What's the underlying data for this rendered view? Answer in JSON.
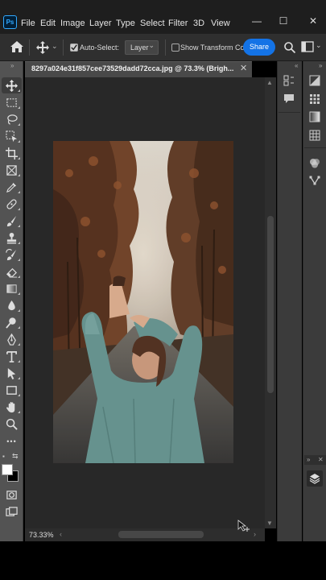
{
  "app": {
    "logo": "Ps"
  },
  "menu": [
    "File",
    "Edit",
    "Image",
    "Layer",
    "Type",
    "Select",
    "Filter",
    "3D",
    "View"
  ],
  "window_controls": {
    "minimize": "—",
    "maximize": "☐",
    "close": "✕"
  },
  "options_bar": {
    "auto_select_label": "Auto-Select:",
    "auto_select_checked": true,
    "target_value": "Layer",
    "show_transform_label": "Show Transform Cont",
    "show_transform_checked": false,
    "share_label": "Share",
    "collapse": "»"
  },
  "document": {
    "tab_title": "8297a024e31f857cee73529dadd72cca.jpg @ 73.3% (Brigh...",
    "close": "✕",
    "zoom": "73.33%"
  },
  "toolbar": {
    "collapse": "»",
    "tools": [
      "move-icon",
      "marquee-icon",
      "lasso-icon",
      "object-select-icon",
      "crop-icon",
      "frame-icon",
      "eyedropper-icon",
      "healing-icon",
      "brush-icon",
      "stamp-icon",
      "history-brush-icon",
      "eraser-icon",
      "gradient-icon",
      "blur-icon",
      "dodge-icon",
      "pen-icon",
      "type-icon",
      "path-select-icon",
      "rectangle-icon",
      "hand-icon",
      "zoom-icon",
      "more-tools-icon"
    ],
    "more_label": "•••"
  },
  "panels": {
    "collapse": "«",
    "expand": "»",
    "close": "✕"
  },
  "colors": {
    "share": "#1473e6",
    "ps_blue": "#31a8ff",
    "foreground": "#ffffff",
    "background": "#000000"
  }
}
